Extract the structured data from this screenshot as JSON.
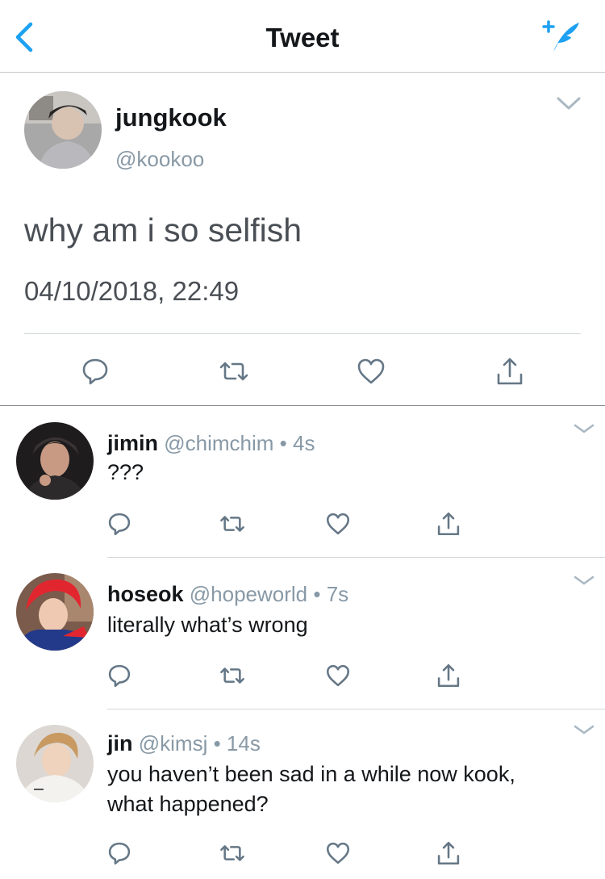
{
  "header": {
    "title": "Tweet",
    "back_icon": "chevron-left-icon",
    "compose_icon": "compose-tweet-icon",
    "accent": "#1da1f2"
  },
  "main_tweet": {
    "name": "jungkook",
    "handle": "@kookoo",
    "text": "why am i so selfish",
    "date": "04/10/2018, 22:49",
    "actions": [
      "reply-icon",
      "retweet-icon",
      "like-icon",
      "share-icon"
    ]
  },
  "replies": [
    {
      "name": "jimin",
      "handle": "@chimchim",
      "dot": "•",
      "time": "4s",
      "text": "???"
    },
    {
      "name": "hoseok",
      "handle": "@hopeworld",
      "dot": "•",
      "time": "7s",
      "text": "literally what’s wrong"
    },
    {
      "name": "jin",
      "handle": "@kimsj",
      "dot": "•",
      "time": "14s",
      "text_line1": "you haven’t been sad in a while now kook,",
      "text_line2": "what happened?"
    }
  ],
  "colors": {
    "text_primary": "#14171a",
    "text_secondary": "#8899a6",
    "icon_gray": "#657786",
    "accent": "#1da1f2"
  }
}
